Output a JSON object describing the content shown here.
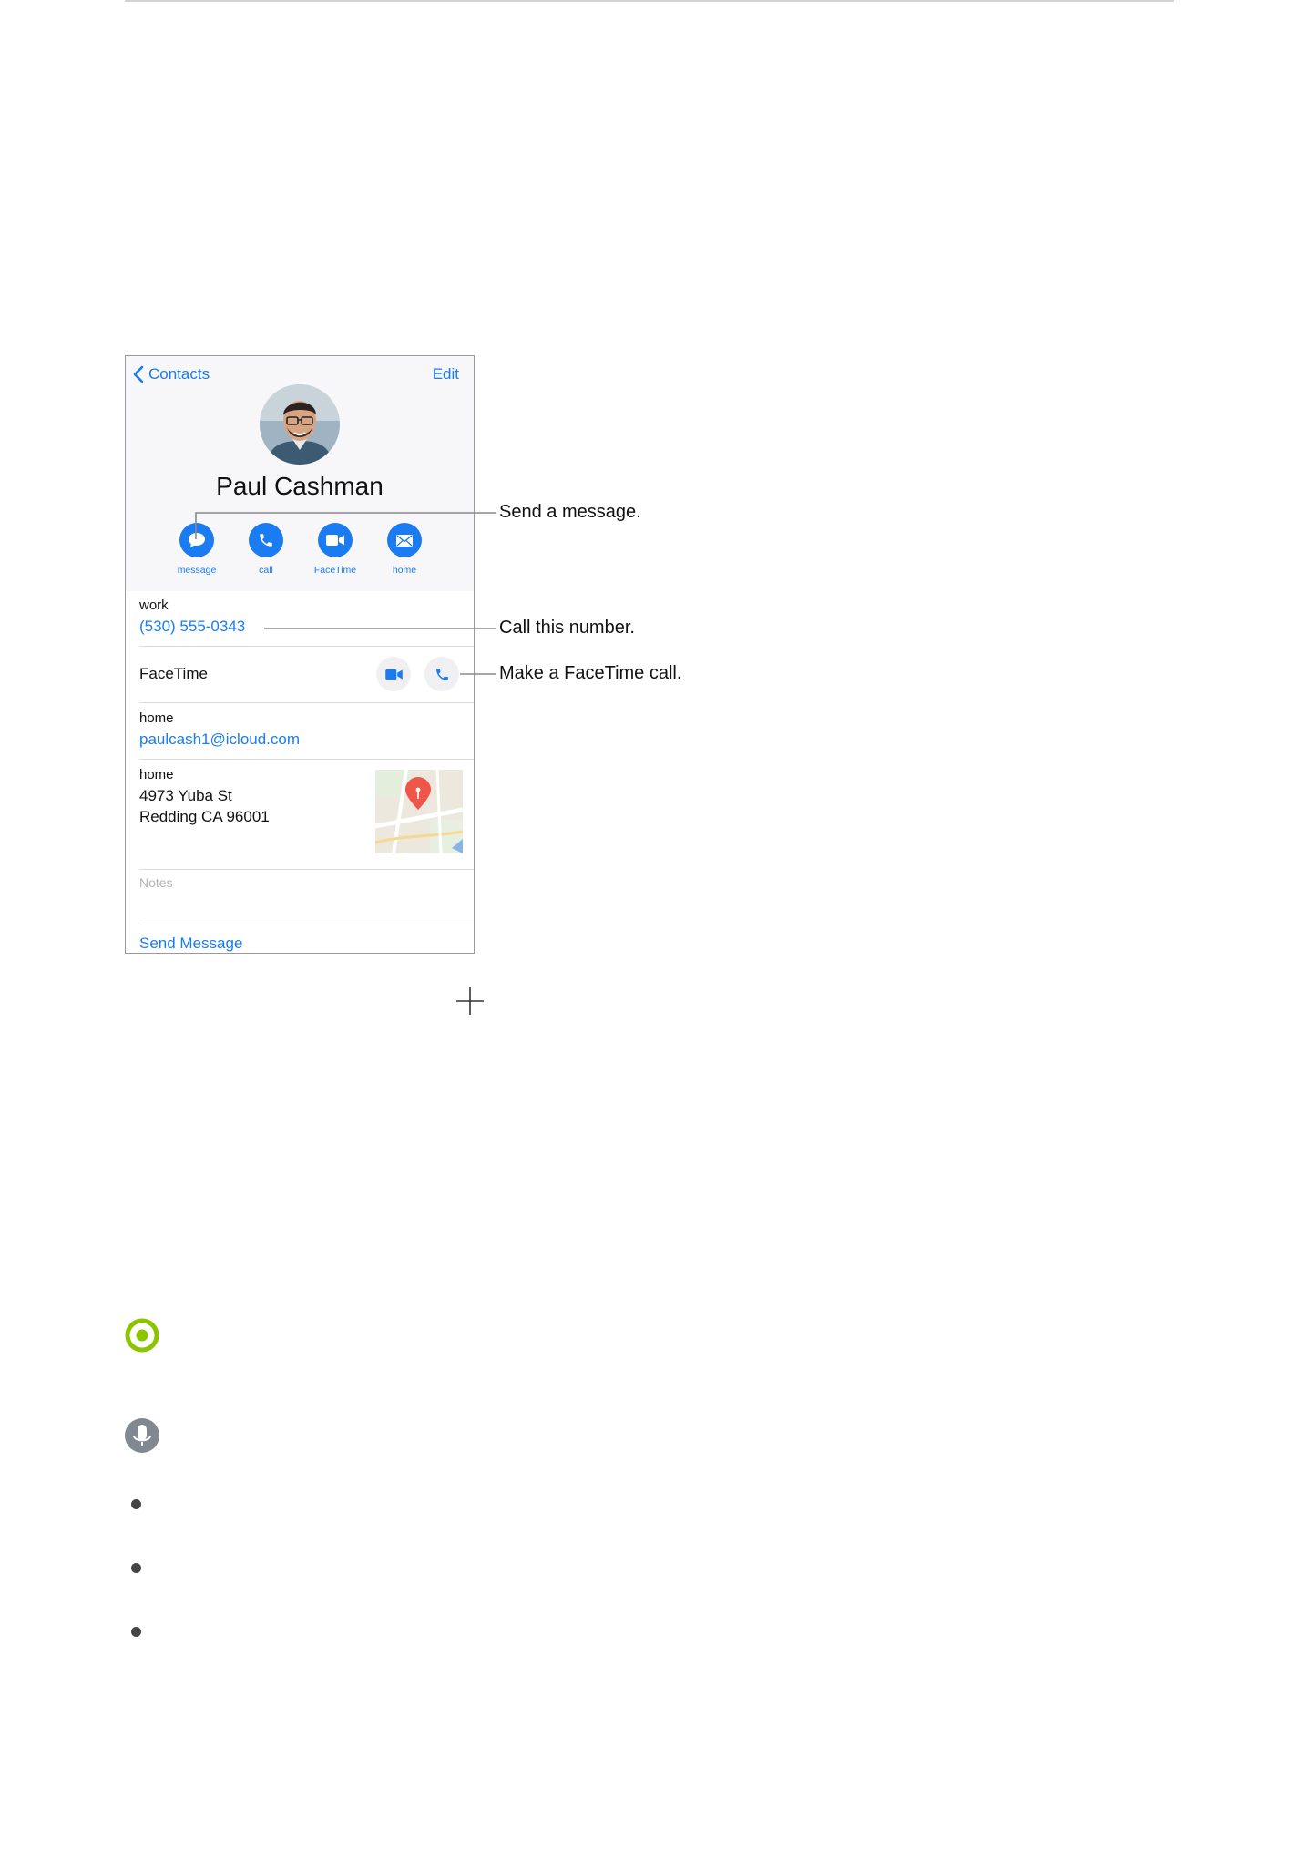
{
  "contact_card": {
    "nav": {
      "back_label": "Contacts",
      "edit_label": "Edit"
    },
    "name": "Paul Cashman",
    "actions": [
      {
        "label": "message",
        "icon": "message-bubble-icon"
      },
      {
        "label": "call",
        "icon": "phone-icon"
      },
      {
        "label": "FaceTime",
        "icon": "video-camera-icon"
      },
      {
        "label": "home",
        "icon": "envelope-icon"
      }
    ],
    "phone": {
      "label": "work",
      "value": "(530) 555-0343"
    },
    "facetime": {
      "label": "FaceTime"
    },
    "email": {
      "label": "home",
      "value": "paulcash1@icloud.com"
    },
    "address": {
      "label": "home",
      "line1": "4973 Yuba St",
      "line2": "Redding CA 96001"
    },
    "notes_placeholder": "Notes",
    "send_message": "Send Message"
  },
  "callouts": {
    "send_message": "Send a message.",
    "call_number": "Call this number.",
    "facetime_call": "Make a FaceTime call."
  },
  "colors": {
    "ios_blue": "#1a7cf0",
    "tip_green": "#8cc400",
    "siri_gray": "#808891",
    "map_pin": "#f0554a"
  }
}
